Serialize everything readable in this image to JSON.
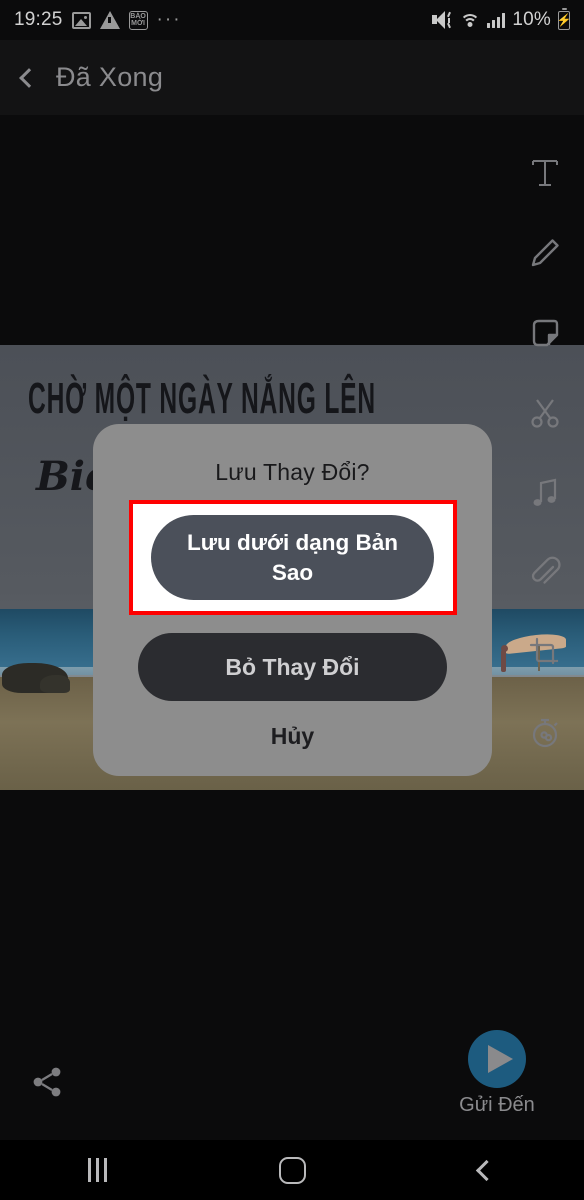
{
  "status_bar": {
    "time": "19:25",
    "battery_percent": "10%",
    "icons": [
      "photo-icon",
      "warning-icon",
      "baomoi-app-icon",
      "more-dots-icon",
      "mute-icon",
      "wifi-icon",
      "signal-icon",
      "battery-charging-icon"
    ],
    "baomoi_line1": "BÁO",
    "baomoi_line2": "MỚI",
    "dots": "···",
    "battery_bolt": "⚡"
  },
  "app_bar": {
    "back_icon": "back-chevron-icon",
    "title": "Đã Xong"
  },
  "tool_rail": {
    "tools": [
      {
        "name": "text-tool",
        "icon": "text-T-icon"
      },
      {
        "name": "draw-tool",
        "icon": "pencil-icon"
      },
      {
        "name": "sticker-tool",
        "icon": "sticker-icon"
      },
      {
        "name": "cut-tool",
        "icon": "scissors-icon"
      },
      {
        "name": "music-tool",
        "icon": "music-note-icon"
      },
      {
        "name": "attach-tool",
        "icon": "paperclip-icon"
      },
      {
        "name": "crop-tool",
        "icon": "crop-icon"
      },
      {
        "name": "timer-tool",
        "icon": "stopwatch-loop-icon"
      }
    ]
  },
  "photo": {
    "headline": "CHỜ MỘT NGÀY NẮNG LÊN",
    "script_text": "Biể"
  },
  "dialog": {
    "title": "Lưu Thay Đổi?",
    "save_copy_label": "Lưu dưới dạng Bản Sao",
    "discard_label": "Bỏ Thay Đổi",
    "cancel_label": "Hủy",
    "highlight_color": "#ff0000",
    "surface_color": "#8d8d8d",
    "primary_button_color": "#4b505a",
    "secondary_button_color": "#2b2c30"
  },
  "bottom_bar": {
    "share_icon": "share-icon",
    "send_icon": "send-triangle-icon",
    "send_label": "Gửi Đến",
    "send_button_color": "#1d5b7f"
  },
  "nav_bar": {
    "recents": "recents-icon",
    "home": "home-icon",
    "back": "back-icon"
  }
}
